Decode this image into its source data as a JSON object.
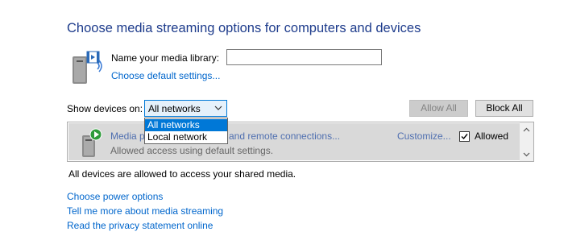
{
  "heading": "Choose media streaming options for computers and devices",
  "library": {
    "label": "Name your media library:",
    "value": "",
    "icon": "media-library-icon",
    "default_settings_link": "Choose default settings..."
  },
  "show_devices": {
    "label": "Show devices on:",
    "selected": "All networks",
    "options": [
      "All networks",
      "Local network"
    ]
  },
  "buttons": {
    "allow_all": "Allow All",
    "block_all": "Block All"
  },
  "device_row": {
    "title_start": "Media p",
    "title_end": "and remote connections...",
    "subtitle": "Allowed access using default settings.",
    "customize": "Customize...",
    "allowed_label": "Allowed",
    "allowed_checked": true,
    "icon": "media-server-icon"
  },
  "status_text": "All devices are allowed to access your shared media.",
  "links": {
    "power": "Choose power options",
    "learn": "Tell me more about media streaming",
    "privacy": "Read the privacy statement online"
  },
  "colors": {
    "heading": "#1e3c8c",
    "link": "#0066cc",
    "selection": "#0078d7",
    "row_background": "#d9d9d9"
  }
}
